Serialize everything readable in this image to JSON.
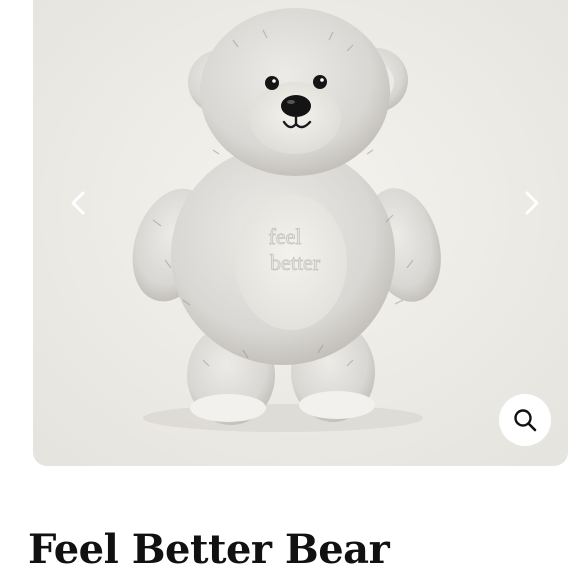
{
  "product": {
    "title": "Feel Better Bear",
    "image": {
      "subject": "plush-bear",
      "belly_text_line1": "feel",
      "belly_text_line2": "better"
    }
  },
  "gallery": {
    "prev_icon": "chevron-left-icon",
    "next_icon": "chevron-right-icon",
    "zoom_icon": "magnifier-icon"
  },
  "colors": {
    "gallery_bg": "#efeee9",
    "plush_fur": "#dedcd8",
    "plush_belly": "#ecebe6",
    "title_text": "#111111"
  }
}
